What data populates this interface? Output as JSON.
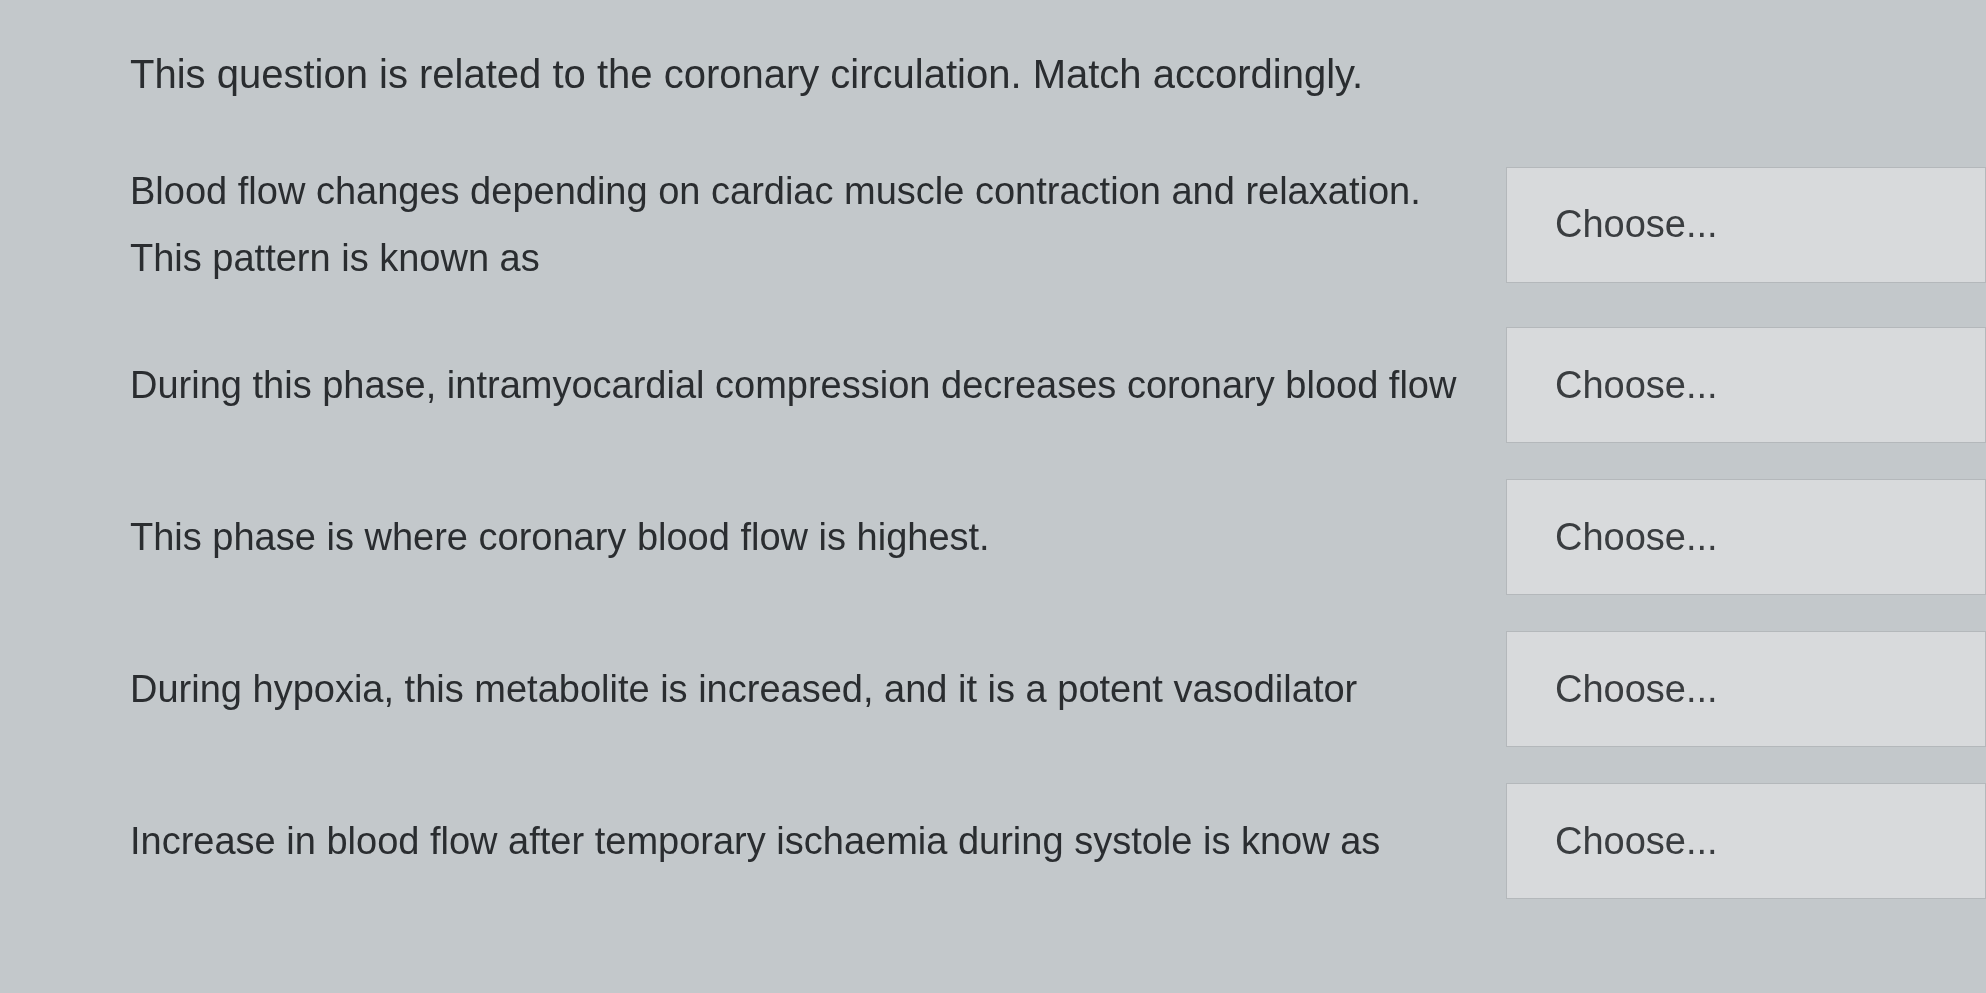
{
  "question": "This question is related to the coronary circulation. Match accordingly.",
  "items": [
    {
      "prompt": "Blood flow changes depending on cardiac muscle contraction and relaxation. This pattern is known as",
      "select": "Choose..."
    },
    {
      "prompt": "During this phase, intramyocardial compression decreases coronary blood flow",
      "select": "Choose..."
    },
    {
      "prompt": "This phase is where coronary blood flow is highest.",
      "select": "Choose..."
    },
    {
      "prompt": "During hypoxia, this metabolite is increased, and it is a potent vasodilator",
      "select": "Choose..."
    },
    {
      "prompt": "Increase in blood flow after temporary ischaemia during systole is know as",
      "select": "Choose..."
    }
  ]
}
